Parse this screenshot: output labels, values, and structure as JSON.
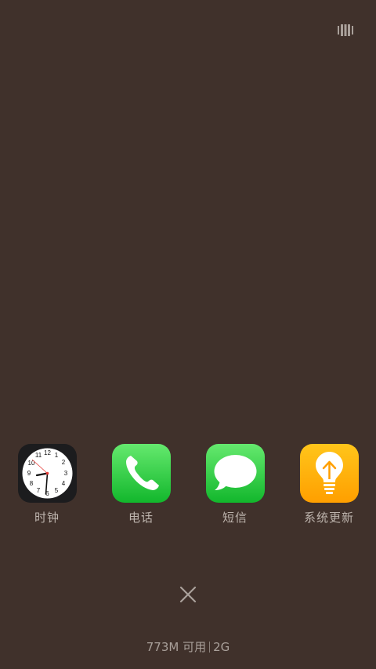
{
  "header": {
    "switch_view_icon": "card-view-icon"
  },
  "apps": [
    {
      "label": "时钟",
      "icon": "clock-icon",
      "color": "#1c1c1e"
    },
    {
      "label": "电话",
      "icon": "phone-icon",
      "color": "#2fc74c"
    },
    {
      "label": "短信",
      "icon": "messages-icon",
      "color": "#2fc74c"
    },
    {
      "label": "系统更新",
      "icon": "system-update-icon",
      "color": "#ffb300"
    }
  ],
  "close_button": {
    "icon": "close-icon"
  },
  "memory": {
    "free_text": "773M 可用",
    "total_text": "2G"
  },
  "colors": {
    "background": "#40312b",
    "label": "#bdb4ad"
  }
}
